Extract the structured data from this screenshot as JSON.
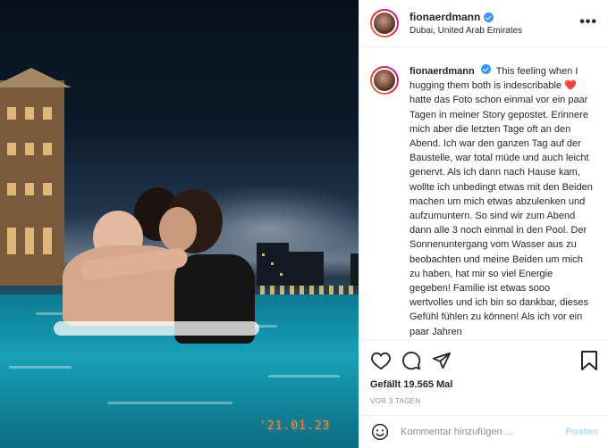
{
  "photo": {
    "date_stamp": "'21.01.23"
  },
  "post": {
    "username": "fionaerdmann",
    "location": "Dubai, United Arab Emirates",
    "more_label": "•••",
    "caption_before": "This feeling when I hugging them both is indescribable ",
    "caption_emoji": "❤️",
    "caption_after": " hatte das Foto schon einmal vor ein paar Tagen in meiner Story gepostet. Erinnere mich aber die letzten Tage oft an den Abend. Ich war den ganzen Tag auf der Baustelle, war total müde und auch leicht genervt. Als ich dann nach Hause kam, wollte ich unbedingt etwas mit den Beiden machen um mich etwas abzulenken und aufzumuntern. So sind wir zum Abend dann alle 3 noch einmal in den Pool. Der Sonnenuntergang vom Wasser aus zu beobachten und meine Beiden um mich zu haben, hat mir so viel Energie gegeben! Familie ist etwas sooo wertvolles und ich bin so dankbar, dieses Gefühl fühlen zu können! Als ich vor ein paar Jahren",
    "likes": "Gefällt 19.565 Mal",
    "time": "VOR 3 TAGEN"
  },
  "comment": {
    "placeholder": "Kommentar hinzufügen ...",
    "post_label": "Posten"
  },
  "colors": {
    "verified": "#3897f0",
    "post_button": "#b2dffc",
    "date_stamp": "#e98b3c"
  }
}
